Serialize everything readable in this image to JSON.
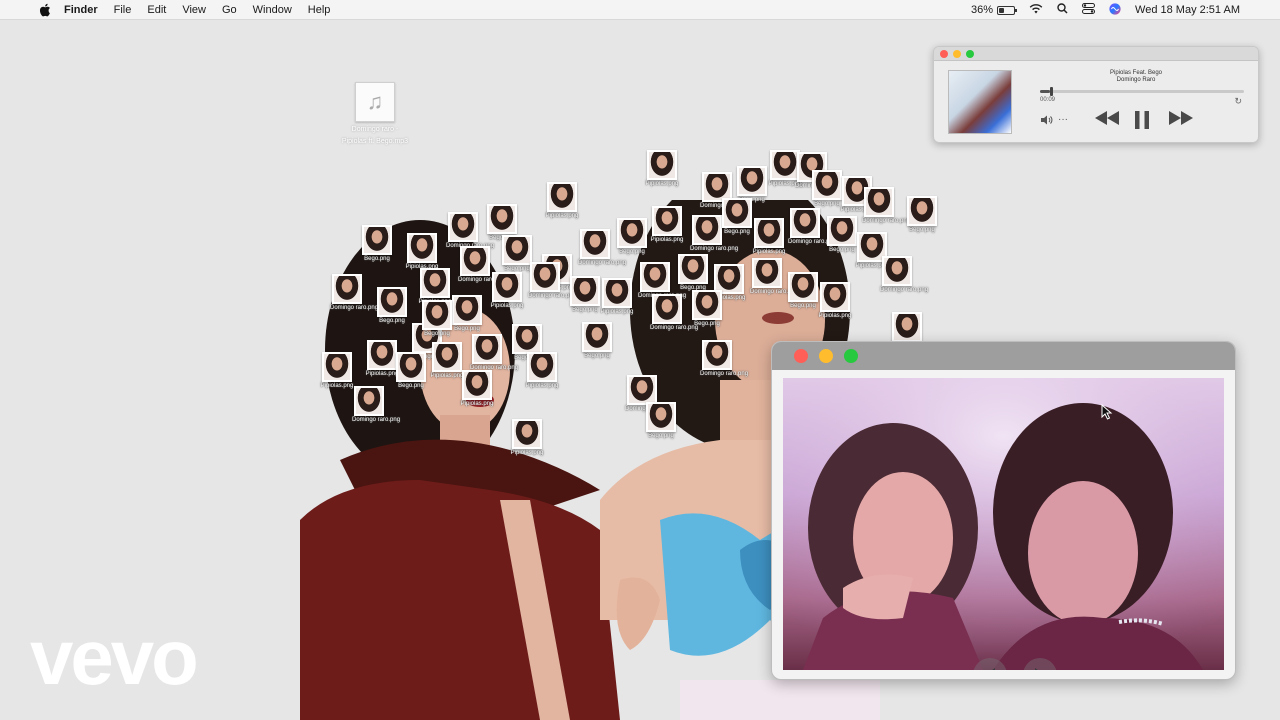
{
  "menubar": {
    "app_name": "Finder",
    "items": [
      "File",
      "Edit",
      "View",
      "Go",
      "Window",
      "Help"
    ],
    "battery_percent": "36%",
    "battery_level": 0.36,
    "datetime": "Wed 18 May  2:51 AM"
  },
  "desktop_file": {
    "name_line1": "Domingo raro -",
    "name_line2": "Pipiolas ft. Bego.mp3",
    "icon": "music-note-icon"
  },
  "png_icons": [
    {
      "label": "Bego.png"
    },
    {
      "label": "Pipiolas.png"
    },
    {
      "label": "Domingo raro.png"
    },
    {
      "label": "Bego.png"
    },
    {
      "label": "Pipiolas.png"
    },
    {
      "label": "Domingo raro.png"
    },
    {
      "label": "Bego.png"
    },
    {
      "label": "Pipiolas.png"
    },
    {
      "label": "Domingo raro.png"
    },
    {
      "label": "Bego.png"
    },
    {
      "label": "Pipiolas.png"
    },
    {
      "label": "Domingo raro.png"
    },
    {
      "label": "Bego.png"
    },
    {
      "label": "Pipiolas.png"
    },
    {
      "label": "Domingo raro.png"
    },
    {
      "label": "Bego.png"
    },
    {
      "label": "Pipiolas.png"
    },
    {
      "label": "Domingo raro.png"
    },
    {
      "label": "Bego.png"
    },
    {
      "label": "Pipiolas.png"
    },
    {
      "label": "Domingo raro.png"
    },
    {
      "label": "Bego.png"
    },
    {
      "label": "Pipiolas.png"
    },
    {
      "label": "Domingo raro.png"
    },
    {
      "label": "Bego.png"
    },
    {
      "label": "Pipiolas.png"
    },
    {
      "label": "Domingo raro.png"
    },
    {
      "label": "Bego.png"
    },
    {
      "label": "Pipiolas.png"
    },
    {
      "label": "Domingo raro.png"
    },
    {
      "label": "Bego.png"
    },
    {
      "label": "Pipiolas.png"
    },
    {
      "label": "Domingo raro.png"
    },
    {
      "label": "Bego.png"
    },
    {
      "label": "Pipiolas.png"
    },
    {
      "label": "Domingo raro.png"
    },
    {
      "label": "Bego.png"
    },
    {
      "label": "Pipiolas.png"
    },
    {
      "label": "Domingo raro.png"
    },
    {
      "label": "Bego.png"
    },
    {
      "label": "Pipiolas.png"
    },
    {
      "label": "Domingo raro.png"
    },
    {
      "label": "Bego.png"
    },
    {
      "label": "Pipiolas.png"
    },
    {
      "label": "Domingo raro.png"
    },
    {
      "label": "Bego.png"
    },
    {
      "label": "Pipiolas.png"
    },
    {
      "label": "Domingo raro.png"
    },
    {
      "label": "Bego.png"
    },
    {
      "label": "Pipiolas.png"
    },
    {
      "label": "Domingo raro.png"
    },
    {
      "label": "Bego.png"
    }
  ],
  "player": {
    "track_title": "Pipiolas Feat. Bego",
    "artist": "Domingo Raro",
    "elapsed": "00:09",
    "progress": 0.05
  },
  "viewer": {
    "prev_icon": "chevron-left-icon",
    "next_icon": "chevron-right-icon"
  },
  "logo": {
    "text": "vevo"
  },
  "colors": {
    "desktop": "#e6e6e6",
    "close": "#ff5f56",
    "minimize": "#ffbd2e",
    "zoom": "#27c93f",
    "dress_red": "#6e1c1a",
    "bow_blue": "#5fb7e0"
  }
}
